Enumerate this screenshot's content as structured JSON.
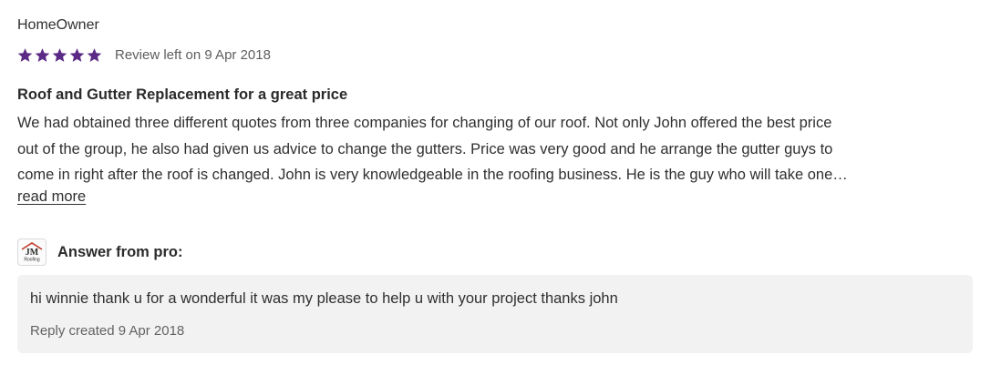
{
  "review": {
    "reviewer": "HomeOwner",
    "rating": 5,
    "rating_max": 5,
    "star_color": "#5b2a86",
    "date": "Review left on 9 Apr 2018",
    "title": "Roof and Gutter Replacement for a great price",
    "body_lines": [
      "We had obtained three different quotes from three companies for changing of our roof. Not only John offered the best price",
      "out of the group, he also had given us advice to change the gutters. Price was very good and he arrange the gutter guys to",
      "come in right after the roof is changed.   John is very knowledgeable in the roofing business. He is the guy who will take one…"
    ],
    "read_more": "read more"
  },
  "pro_answer": {
    "logo_text": "JM",
    "logo_subtext": "Roofing",
    "logo_icon": "company-logo",
    "label": "Answer from pro:",
    "reply": "hi winnie thank u for a wonderful it was my please to help u with your project thanks john",
    "reply_date": "Reply created 9 Apr 2018"
  }
}
